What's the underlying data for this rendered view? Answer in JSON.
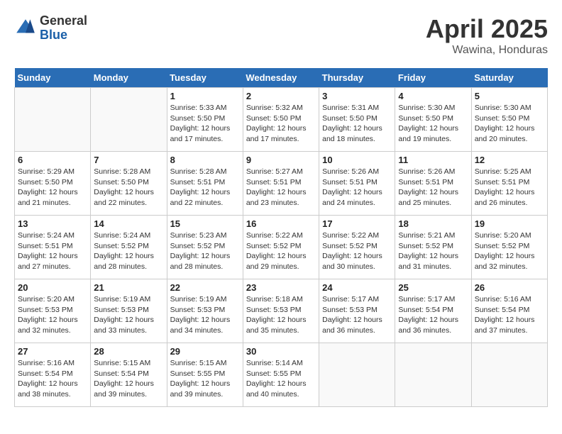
{
  "header": {
    "logo_general": "General",
    "logo_blue": "Blue",
    "month": "April 2025",
    "location": "Wawina, Honduras"
  },
  "days_of_week": [
    "Sunday",
    "Monday",
    "Tuesday",
    "Wednesday",
    "Thursday",
    "Friday",
    "Saturday"
  ],
  "weeks": [
    [
      {
        "day": null
      },
      {
        "day": null
      },
      {
        "day": 1,
        "sunrise": "Sunrise: 5:33 AM",
        "sunset": "Sunset: 5:50 PM",
        "daylight": "Daylight: 12 hours and 17 minutes."
      },
      {
        "day": 2,
        "sunrise": "Sunrise: 5:32 AM",
        "sunset": "Sunset: 5:50 PM",
        "daylight": "Daylight: 12 hours and 17 minutes."
      },
      {
        "day": 3,
        "sunrise": "Sunrise: 5:31 AM",
        "sunset": "Sunset: 5:50 PM",
        "daylight": "Daylight: 12 hours and 18 minutes."
      },
      {
        "day": 4,
        "sunrise": "Sunrise: 5:30 AM",
        "sunset": "Sunset: 5:50 PM",
        "daylight": "Daylight: 12 hours and 19 minutes."
      },
      {
        "day": 5,
        "sunrise": "Sunrise: 5:30 AM",
        "sunset": "Sunset: 5:50 PM",
        "daylight": "Daylight: 12 hours and 20 minutes."
      }
    ],
    [
      {
        "day": 6,
        "sunrise": "Sunrise: 5:29 AM",
        "sunset": "Sunset: 5:50 PM",
        "daylight": "Daylight: 12 hours and 21 minutes."
      },
      {
        "day": 7,
        "sunrise": "Sunrise: 5:28 AM",
        "sunset": "Sunset: 5:50 PM",
        "daylight": "Daylight: 12 hours and 22 minutes."
      },
      {
        "day": 8,
        "sunrise": "Sunrise: 5:28 AM",
        "sunset": "Sunset: 5:51 PM",
        "daylight": "Daylight: 12 hours and 22 minutes."
      },
      {
        "day": 9,
        "sunrise": "Sunrise: 5:27 AM",
        "sunset": "Sunset: 5:51 PM",
        "daylight": "Daylight: 12 hours and 23 minutes."
      },
      {
        "day": 10,
        "sunrise": "Sunrise: 5:26 AM",
        "sunset": "Sunset: 5:51 PM",
        "daylight": "Daylight: 12 hours and 24 minutes."
      },
      {
        "day": 11,
        "sunrise": "Sunrise: 5:26 AM",
        "sunset": "Sunset: 5:51 PM",
        "daylight": "Daylight: 12 hours and 25 minutes."
      },
      {
        "day": 12,
        "sunrise": "Sunrise: 5:25 AM",
        "sunset": "Sunset: 5:51 PM",
        "daylight": "Daylight: 12 hours and 26 minutes."
      }
    ],
    [
      {
        "day": 13,
        "sunrise": "Sunrise: 5:24 AM",
        "sunset": "Sunset: 5:51 PM",
        "daylight": "Daylight: 12 hours and 27 minutes."
      },
      {
        "day": 14,
        "sunrise": "Sunrise: 5:24 AM",
        "sunset": "Sunset: 5:52 PM",
        "daylight": "Daylight: 12 hours and 28 minutes."
      },
      {
        "day": 15,
        "sunrise": "Sunrise: 5:23 AM",
        "sunset": "Sunset: 5:52 PM",
        "daylight": "Daylight: 12 hours and 28 minutes."
      },
      {
        "day": 16,
        "sunrise": "Sunrise: 5:22 AM",
        "sunset": "Sunset: 5:52 PM",
        "daylight": "Daylight: 12 hours and 29 minutes."
      },
      {
        "day": 17,
        "sunrise": "Sunrise: 5:22 AM",
        "sunset": "Sunset: 5:52 PM",
        "daylight": "Daylight: 12 hours and 30 minutes."
      },
      {
        "day": 18,
        "sunrise": "Sunrise: 5:21 AM",
        "sunset": "Sunset: 5:52 PM",
        "daylight": "Daylight: 12 hours and 31 minutes."
      },
      {
        "day": 19,
        "sunrise": "Sunrise: 5:20 AM",
        "sunset": "Sunset: 5:52 PM",
        "daylight": "Daylight: 12 hours and 32 minutes."
      }
    ],
    [
      {
        "day": 20,
        "sunrise": "Sunrise: 5:20 AM",
        "sunset": "Sunset: 5:53 PM",
        "daylight": "Daylight: 12 hours and 32 minutes."
      },
      {
        "day": 21,
        "sunrise": "Sunrise: 5:19 AM",
        "sunset": "Sunset: 5:53 PM",
        "daylight": "Daylight: 12 hours and 33 minutes."
      },
      {
        "day": 22,
        "sunrise": "Sunrise: 5:19 AM",
        "sunset": "Sunset: 5:53 PM",
        "daylight": "Daylight: 12 hours and 34 minutes."
      },
      {
        "day": 23,
        "sunrise": "Sunrise: 5:18 AM",
        "sunset": "Sunset: 5:53 PM",
        "daylight": "Daylight: 12 hours and 35 minutes."
      },
      {
        "day": 24,
        "sunrise": "Sunrise: 5:17 AM",
        "sunset": "Sunset: 5:53 PM",
        "daylight": "Daylight: 12 hours and 36 minutes."
      },
      {
        "day": 25,
        "sunrise": "Sunrise: 5:17 AM",
        "sunset": "Sunset: 5:54 PM",
        "daylight": "Daylight: 12 hours and 36 minutes."
      },
      {
        "day": 26,
        "sunrise": "Sunrise: 5:16 AM",
        "sunset": "Sunset: 5:54 PM",
        "daylight": "Daylight: 12 hours and 37 minutes."
      }
    ],
    [
      {
        "day": 27,
        "sunrise": "Sunrise: 5:16 AM",
        "sunset": "Sunset: 5:54 PM",
        "daylight": "Daylight: 12 hours and 38 minutes."
      },
      {
        "day": 28,
        "sunrise": "Sunrise: 5:15 AM",
        "sunset": "Sunset: 5:54 PM",
        "daylight": "Daylight: 12 hours and 39 minutes."
      },
      {
        "day": 29,
        "sunrise": "Sunrise: 5:15 AM",
        "sunset": "Sunset: 5:55 PM",
        "daylight": "Daylight: 12 hours and 39 minutes."
      },
      {
        "day": 30,
        "sunrise": "Sunrise: 5:14 AM",
        "sunset": "Sunset: 5:55 PM",
        "daylight": "Daylight: 12 hours and 40 minutes."
      },
      {
        "day": null
      },
      {
        "day": null
      },
      {
        "day": null
      }
    ]
  ]
}
